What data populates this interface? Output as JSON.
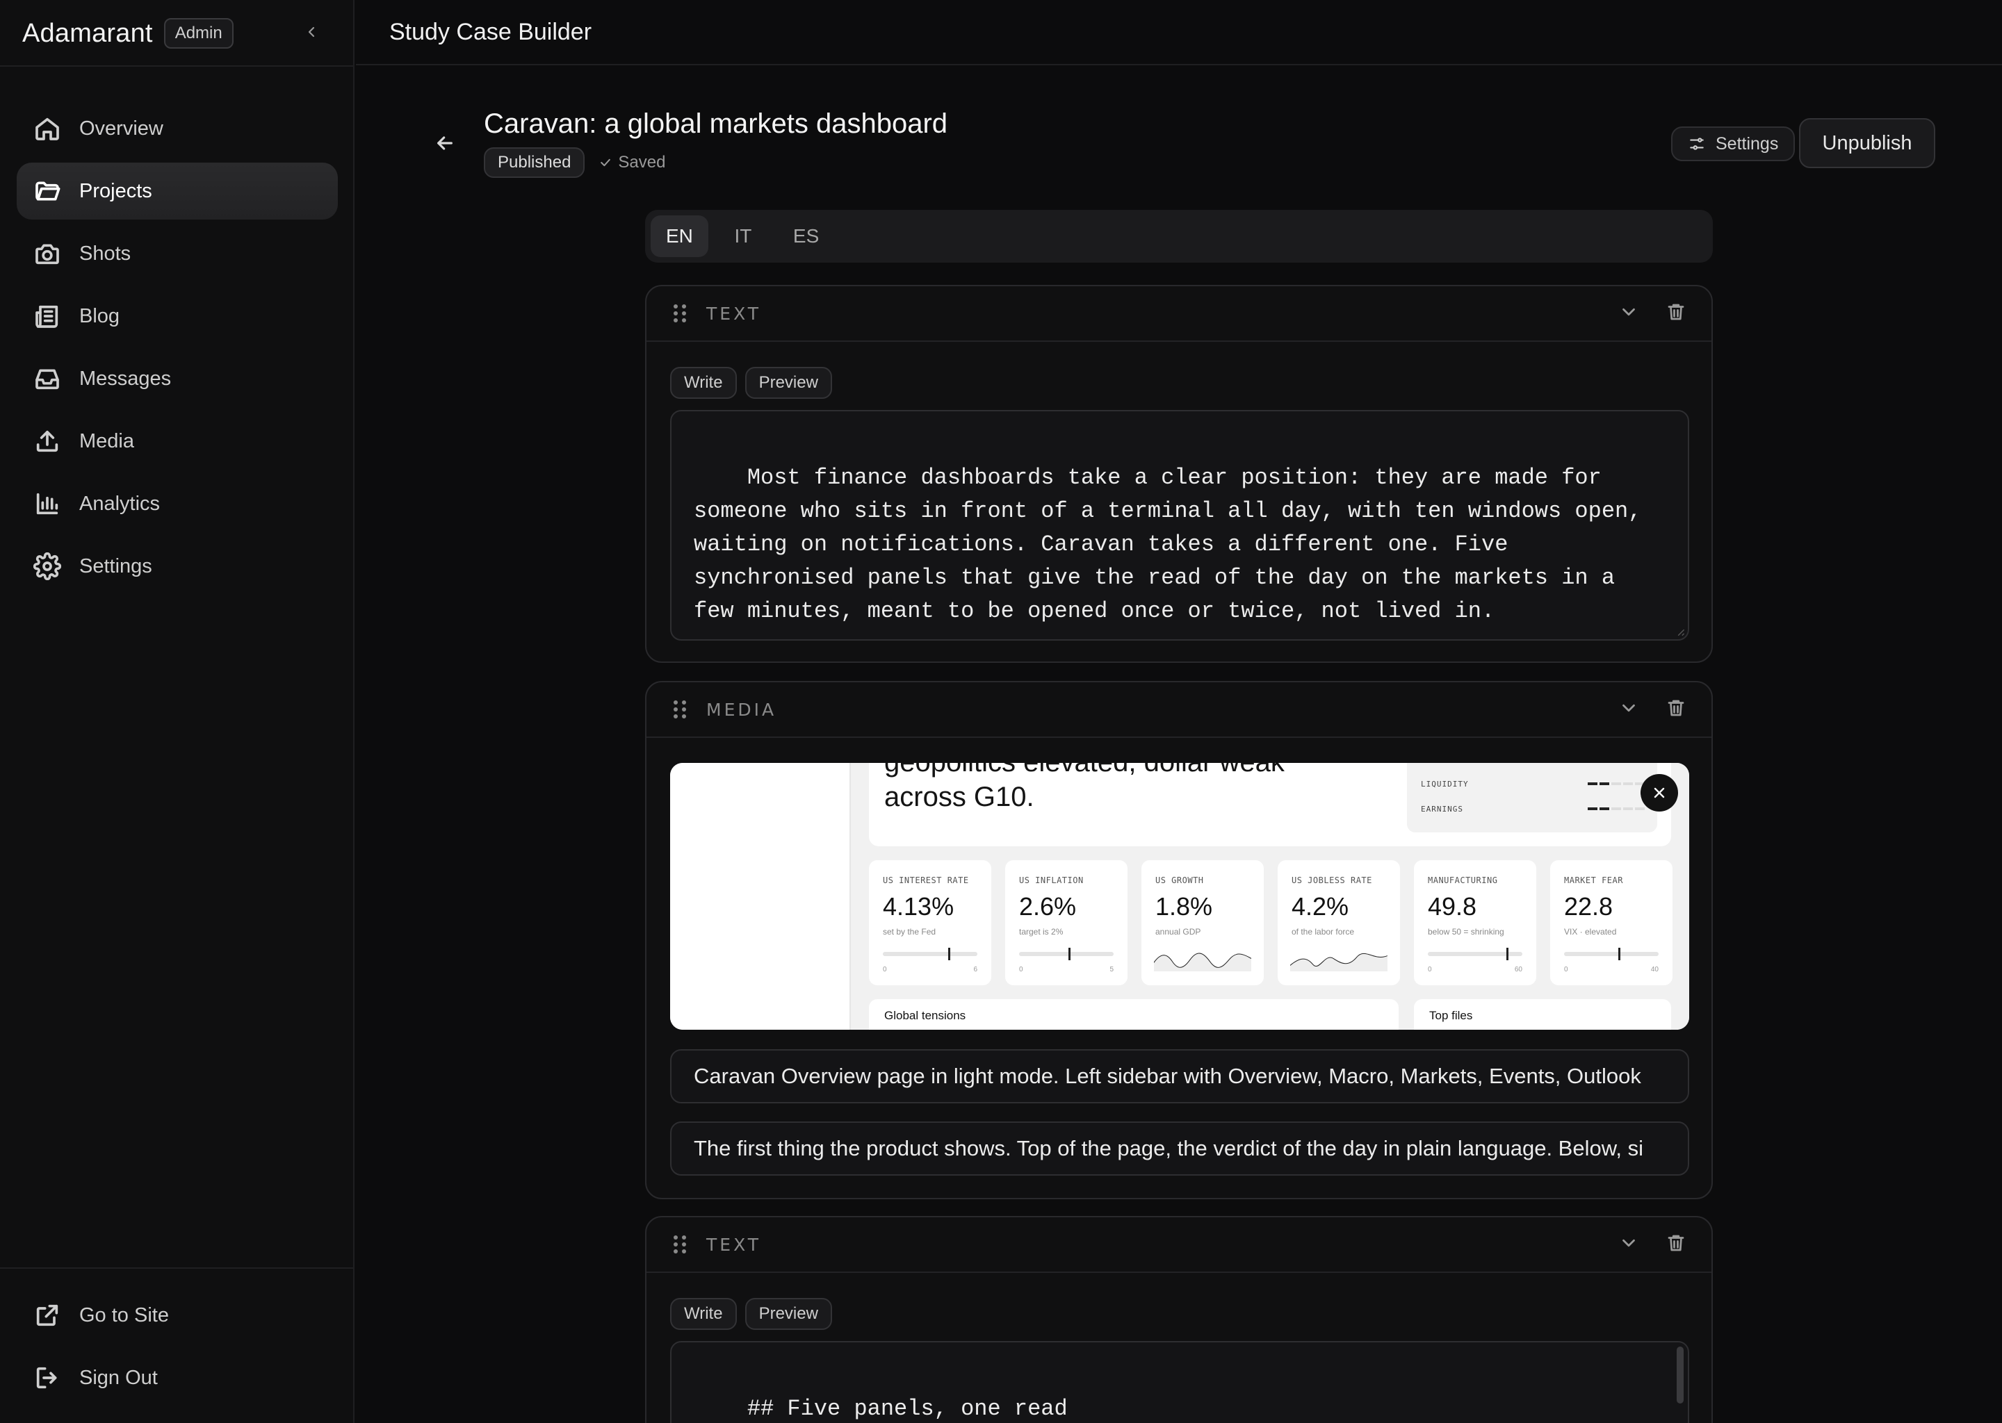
{
  "app": {
    "brand": "Adamarant",
    "badge": "Admin"
  },
  "sidebar": {
    "items": [
      {
        "label": "Overview",
        "icon": "home-icon"
      },
      {
        "label": "Projects",
        "icon": "folder-icon",
        "active": true
      },
      {
        "label": "Shots",
        "icon": "camera-icon"
      },
      {
        "label": "Blog",
        "icon": "newspaper-icon"
      },
      {
        "label": "Messages",
        "icon": "inbox-icon"
      },
      {
        "label": "Media",
        "icon": "upload-icon"
      },
      {
        "label": "Analytics",
        "icon": "bar-chart-icon"
      },
      {
        "label": "Settings",
        "icon": "gear-icon"
      }
    ],
    "bottom": [
      {
        "label": "Go to Site",
        "icon": "external-link-icon"
      },
      {
        "label": "Sign Out",
        "icon": "sign-out-icon"
      }
    ]
  },
  "topbar": {
    "title": "Study Case Builder"
  },
  "doc": {
    "title": "Caravan: a global markets dashboard",
    "status": "Published",
    "saved": "Saved",
    "settings_label": "Settings",
    "unpublish_label": "Unpublish"
  },
  "languages": [
    {
      "code": "EN",
      "active": true
    },
    {
      "code": "IT"
    },
    {
      "code": "ES"
    }
  ],
  "blocks": {
    "text1": {
      "type": "TEXT",
      "write": "Write",
      "preview": "Preview",
      "content": "Most finance dashboards take a clear position: they are made for someone who sits in front of a terminal all day, with ten windows open, waiting on notifications. Caravan takes a different one. Five synchronised panels that give the read of the day on the markets in a few minutes, meant to be opened once or twice, not lived in."
    },
    "media": {
      "type": "MEDIA",
      "alt_text": "Caravan Overview page in light mode. Left sidebar with Overview, Macro, Markets, Events, Outlook",
      "caption": "The first thing the product shows. Top of the page, the verdict of the day in plain language. Below, si",
      "preview": {
        "headline": "geopolitics elevated, dollar weak across G10.",
        "signals": [
          "LIQUIDITY",
          "EARNINGS"
        ],
        "kpis": [
          {
            "label": "US INTEREST RATE",
            "value": "4.13%",
            "sub": "set by the Fed",
            "min": "0",
            "max": "6",
            "level": 0.69
          },
          {
            "label": "US INFLATION",
            "value": "2.6%",
            "sub": "target is 2%",
            "min": "0",
            "max": "5",
            "level": 0.52
          },
          {
            "label": "US GROWTH",
            "value": "1.8%",
            "sub": "annual GDP",
            "spark": true
          },
          {
            "label": "US JOBLESS RATE",
            "value": "4.2%",
            "sub": "of the labor force",
            "spark": true
          },
          {
            "label": "MANUFACTURING",
            "value": "49.8",
            "sub": "below 50 = shrinking",
            "min": "0",
            "max": "60",
            "level": 0.83
          },
          {
            "label": "MARKET FEAR",
            "value": "22.8",
            "sub": "VIX · elevated",
            "min": "0",
            "max": "40",
            "level": 0.57
          }
        ],
        "bottom_left": "Global tensions",
        "bottom_right": "Top files"
      }
    },
    "text2": {
      "type": "TEXT",
      "write": "Write",
      "preview": "Preview",
      "content": "## Five panels, one read"
    }
  }
}
